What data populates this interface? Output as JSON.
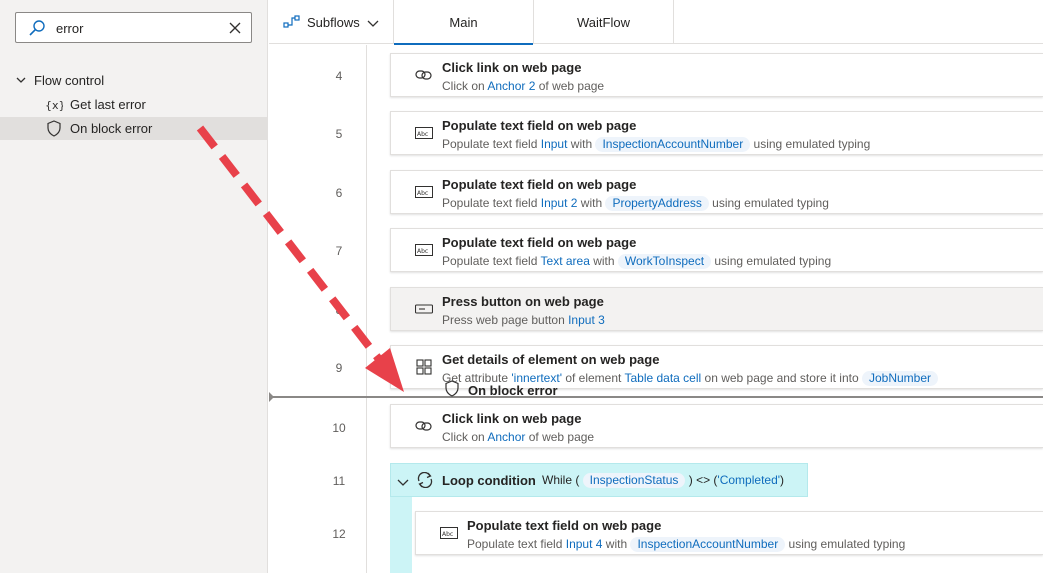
{
  "search": {
    "value": "error"
  },
  "sidebar": {
    "group_label": "Flow control",
    "items": [
      {
        "label": "Get last error",
        "icon": "variable-x-icon"
      },
      {
        "label": "On block error",
        "icon": "shield-icon",
        "selected": true
      }
    ]
  },
  "topbar": {
    "subflows_label": "Subflows",
    "tabs": [
      {
        "label": "Main",
        "active": true
      },
      {
        "label": "WaitFlow",
        "active": false
      }
    ]
  },
  "steps": [
    {
      "num": "4",
      "title": "Click link on web page",
      "icon": "link-icon",
      "desc": {
        "pre": "Click on ",
        "link": "Anchor 2",
        "post": " of web page"
      }
    },
    {
      "num": "5",
      "title": "Populate text field on web page",
      "icon": "textfield-icon",
      "desc": {
        "pre": "Populate text field ",
        "link": "Input",
        "mid": " with ",
        "pill": "InspectionAccountNumber",
        "post": " using emulated typing"
      }
    },
    {
      "num": "6",
      "title": "Populate text field on web page",
      "icon": "textfield-icon",
      "desc": {
        "pre": "Populate text field ",
        "link": "Input 2",
        "mid": " with ",
        "pill": "PropertyAddress",
        "post": " using emulated typing"
      }
    },
    {
      "num": "7",
      "title": "Populate text field on web page",
      "icon": "textfield-icon",
      "desc": {
        "pre": "Populate text field ",
        "link": "Text area",
        "mid": " with ",
        "pill": "WorkToInspect",
        "post": " using emulated typing"
      }
    },
    {
      "num": "8",
      "title": "Press button on web page",
      "icon": "button-icon",
      "desc": {
        "pre": "Press web page button ",
        "link": "Input 3"
      }
    },
    {
      "num": "9",
      "title": "Get details of element on web page",
      "icon": "element-details-icon",
      "desc": {
        "pre": "Get attribute ",
        "link": "'innertext'",
        "mid": " of element ",
        "link2": "Table data cell",
        "mid2": " on web page and store it into ",
        "pill": "JobNumber"
      }
    },
    {
      "num": "10",
      "title": "Click link on web page",
      "icon": "link-icon",
      "desc": {
        "pre": "Click on ",
        "link": "Anchor",
        "post": " of web page"
      }
    },
    {
      "num": "11"
    },
    {
      "num": "12",
      "title": "Populate text field on web page",
      "icon": "textfield-icon",
      "desc": {
        "pre": "Populate text field ",
        "link": "Input 4",
        "mid": " with ",
        "pill": "InspectionAccountNumber",
        "post": " using emulated typing"
      }
    }
  ],
  "loop": {
    "title": "Loop condition",
    "desc_pre": "While ( ",
    "pill": "InspectionStatus",
    "desc_mid": " ) <> (",
    "link": "'Completed'",
    "desc_post": ")"
  },
  "drag_ghost": {
    "label": "On block error"
  },
  "colors": {
    "accent": "#0f6cbd",
    "arrow": "#e8414a",
    "loop_bg": "#ccf4f6"
  }
}
